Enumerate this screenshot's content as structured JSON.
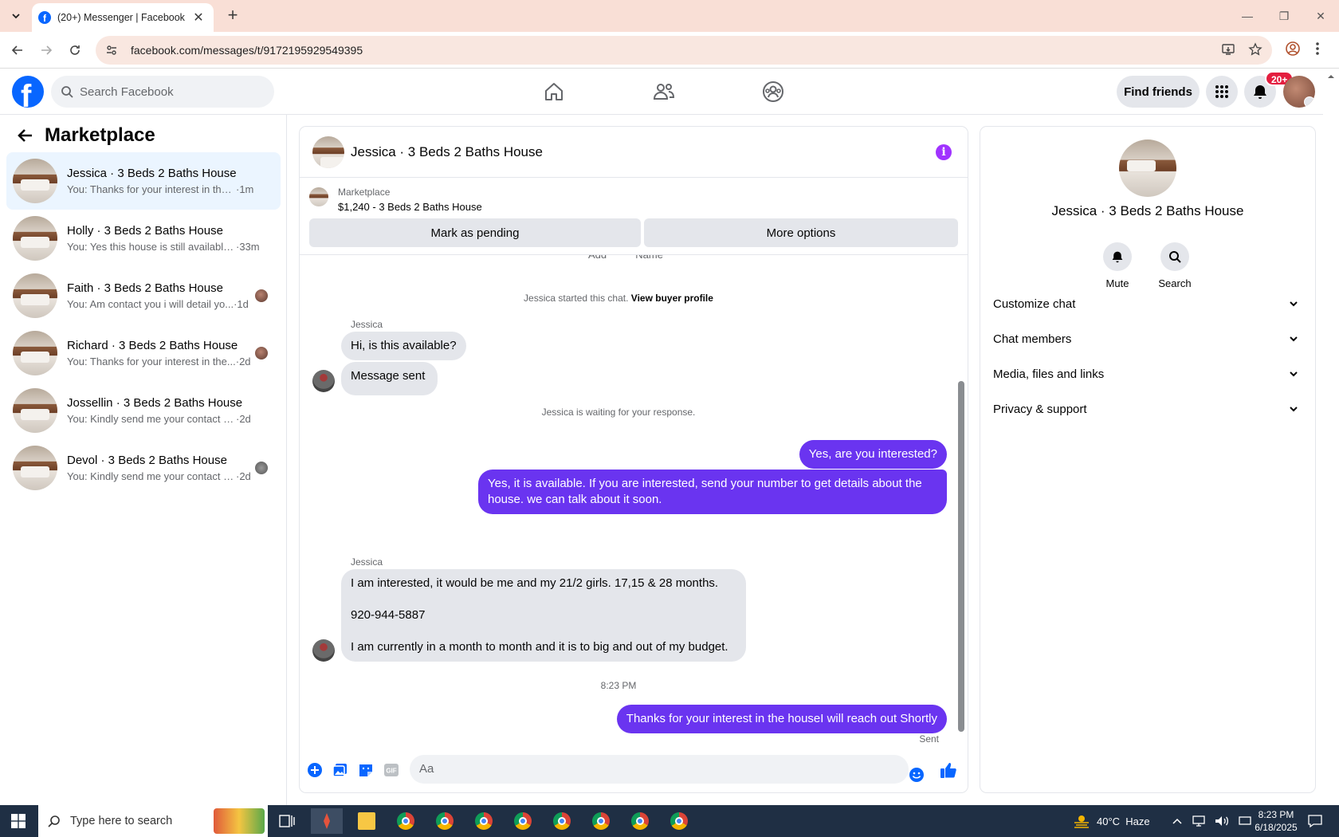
{
  "browser": {
    "tab_title": "(20+) Messenger | Facebook",
    "url": "facebook.com/messages/t/9172195929549395"
  },
  "fb": {
    "search_placeholder": "Search Facebook",
    "find_friends": "Find friends",
    "notif_badge": "20+"
  },
  "sidebar": {
    "title": "Marketplace",
    "conversations": [
      {
        "name": "Jessica · 3 Beds 2 Baths House",
        "snippet": "You: Thanks for your interest in the h...",
        "time": "·1m",
        "active": true
      },
      {
        "name": "Holly · 3 Beds 2 Baths House",
        "snippet": "You: Yes this house is still available f...",
        "time": "·33m"
      },
      {
        "name": "Faith · 3 Beds 2 Baths House",
        "snippet": "You: Am contact you i will detail yo...",
        "time": "·1d"
      },
      {
        "name": "Richard · 3 Beds 2 Baths House",
        "snippet": "You: Thanks for your interest in the...",
        "time": "·2d"
      },
      {
        "name": "Jossellin · 3 Beds 2 Baths House",
        "snippet": "You: Kindly send me your contact nu...",
        "time": "·2d"
      },
      {
        "name": "Devol · 3 Beds 2 Baths House",
        "snippet": "You: Kindly send me your contact n...",
        "time": "·2d"
      }
    ]
  },
  "chat": {
    "title": "Jessica · 3 Beds 2 Baths House",
    "listing_label": "Marketplace",
    "listing_price": "$1,240 - 3 Beds 2 Baths House",
    "mark_pending": "Mark as pending",
    "more_options": "More options",
    "clipped_top": "Add          Name",
    "started_note": "Jessica started this chat.",
    "view_buyer": "View buyer profile",
    "sender_name": "Jessica",
    "msg_1": "Hi, is this available?",
    "msg_2": "Message sent",
    "waiting_note": "Jessica is waiting for your response.",
    "msg_3": "Yes, are you interested?",
    "msg_4": "Yes, it is available. If you are interested, send your number to get details about the house. we can talk about it soon.",
    "msg_5a": "I am interested, it would be me and my 21/2 girls. 17,15 & 28 months.",
    "msg_5b": "920-944-5887",
    "msg_5c": "I am currently in a month to month and it is to big and out of my budget.",
    "timestamp": "8:23 PM",
    "msg_6": "Thanks for your interest in the houseI will reach out Shortly",
    "sent_status": "Sent",
    "input_placeholder": "Aa"
  },
  "details": {
    "name": "Jessica · 3 Beds 2 Baths House",
    "mute": "Mute",
    "search": "Search",
    "rows": [
      "Customize chat",
      "Chat members",
      "Media, files and links",
      "Privacy & support"
    ]
  },
  "taskbar": {
    "search_placeholder": "Type here to search",
    "weather": "40°C  Haze",
    "time": "8:23 PM",
    "date": "6/18/2025"
  },
  "colors": {
    "fb_blue": "#0866ff",
    "outgoing_bubble": "#6a34f0",
    "incoming_bubble": "#e4e6eb",
    "info_purple": "#a033ff",
    "badge_red": "#e41e3f"
  }
}
